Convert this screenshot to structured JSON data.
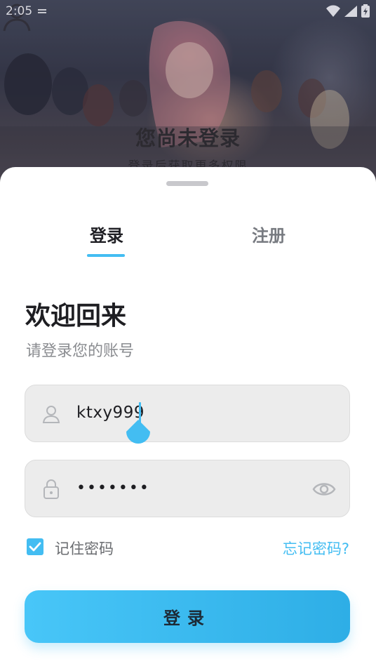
{
  "status_bar": {
    "time": "2:05"
  },
  "hero": {
    "title": "您尚未登录",
    "subtitle": "登录后获取更多权限"
  },
  "tabs": [
    {
      "label": "登录",
      "active": true
    },
    {
      "label": "注册",
      "active": false
    }
  ],
  "form": {
    "welcome": "欢迎回来",
    "subtitle": "请登录您的账号",
    "username": "ktxy999",
    "password_mask": "•••••••",
    "remember_label": "记住密码",
    "remember_checked": true,
    "forgot_label": "忘记密码?",
    "submit_label": "登录"
  },
  "colors": {
    "accent": "#43bdf2",
    "field_bg": "#ececec",
    "sheet_bg": "#ffffff"
  },
  "icons": {
    "username": "person-icon",
    "password": "lock-icon",
    "toggle_visibility": "eye-icon",
    "checkbox": "checkmark-icon"
  }
}
